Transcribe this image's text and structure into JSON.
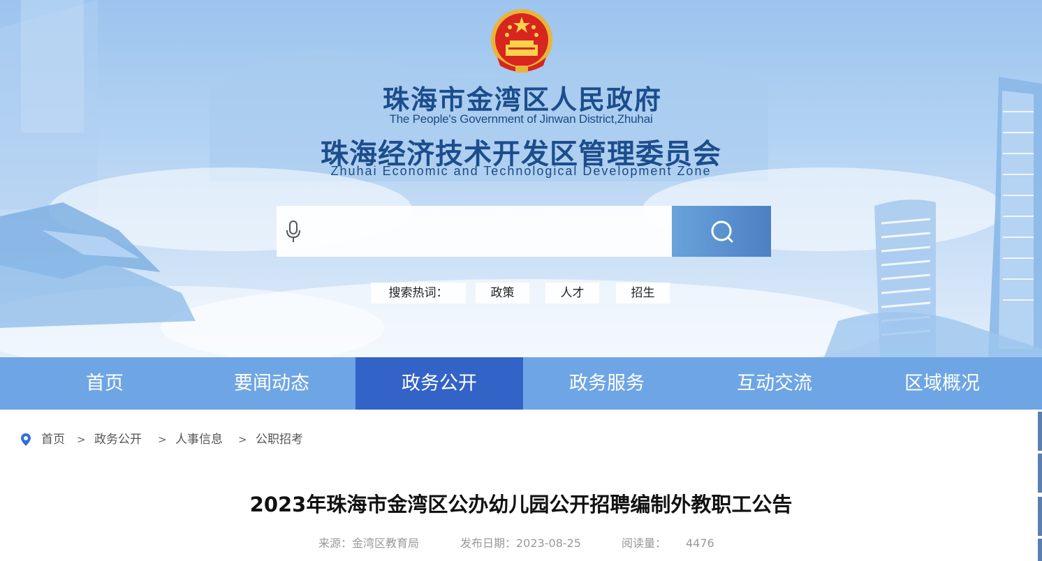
{
  "header": {
    "title_cn": "珠海市金湾区人民政府",
    "title_en": "The People's Government of Jinwan District,Zhuhai",
    "subtitle_cn": "珠海经济技术开发区管理委员会",
    "subtitle_en": "Zhuhai Economic and Technological Development Zone"
  },
  "search": {
    "placeholder": "",
    "hot_label": "搜索热词：",
    "hot_words": [
      "政策",
      "人才",
      "招生"
    ]
  },
  "nav": {
    "items": [
      "首页",
      "要闻动态",
      "政务公开",
      "政务服务",
      "互动交流",
      "区域概况"
    ],
    "active": "政务公开"
  },
  "breadcrumb": {
    "items": [
      "首页",
      "政务公开",
      "人事信息",
      "公职招考"
    ],
    "separator": ">"
  },
  "article": {
    "title": "2023年珠海市金湾区公办幼儿园公开招聘编制外教职工公告",
    "source": "来源：金湾区教育局",
    "date": "发布日期：2023-08-25",
    "views_label": "阅读量：",
    "views": "4476"
  },
  "colors": {
    "nav_bg": "#6ea5e5",
    "nav_active": "#3363c7",
    "title_blue": "#1c4d8c"
  }
}
